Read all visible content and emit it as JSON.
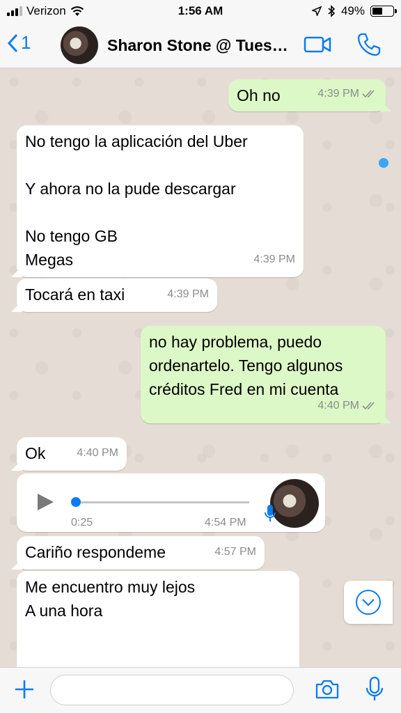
{
  "status_bar": {
    "carrier": "Verizon",
    "time": "1:56 AM",
    "battery_percent": "49%",
    "battery_level": 0.49,
    "icons": [
      "signal-icon",
      "wifi-icon",
      "location-arrow-icon",
      "bluetooth-icon",
      "battery-icon"
    ]
  },
  "header": {
    "back_count": "1",
    "contact_name": "Sharon Stone @ Tues…",
    "icons": [
      "back-chevron-icon",
      "video-call-icon",
      "phone-call-icon"
    ]
  },
  "messages": [
    {
      "direction": "outgoing",
      "text": "Oh no",
      "time": "4:39 PM",
      "status": "read"
    },
    {
      "direction": "incoming",
      "text": "No tengo la aplicación del Uber\n\nY ahora no la pude descargar\n\nNo tengo GB\nMegas",
      "time": "4:39 PM"
    },
    {
      "direction": "incoming",
      "text": "Tocará en taxi",
      "time": "4:39 PM"
    },
    {
      "direction": "outgoing",
      "text": "no hay problema, puedo\nordenartelo. Tengo algunos\ncréditos Fred en mi cuenta",
      "time": "4:40 PM",
      "status": "read"
    },
    {
      "direction": "incoming",
      "text": "Ok",
      "time": "4:40 PM"
    },
    {
      "direction": "incoming",
      "type": "voice",
      "duration": "0:25",
      "time": "4:54 PM",
      "progress": 0.0
    },
    {
      "direction": "incoming",
      "text": "Cariño respondeme",
      "time": "4:57 PM"
    },
    {
      "direction": "incoming",
      "text": "Me encuentro muy lejos\nA una hora"
    }
  ],
  "input_bar": {
    "placeholder": "",
    "icons": [
      "plus-icon",
      "camera-icon",
      "microphone-icon"
    ]
  },
  "colors": {
    "accent": "#0a7bf5",
    "outgoing_bubble": "#dcf8c6",
    "incoming_bubble": "#ffffff",
    "chat_background": "#e5ddd5"
  }
}
